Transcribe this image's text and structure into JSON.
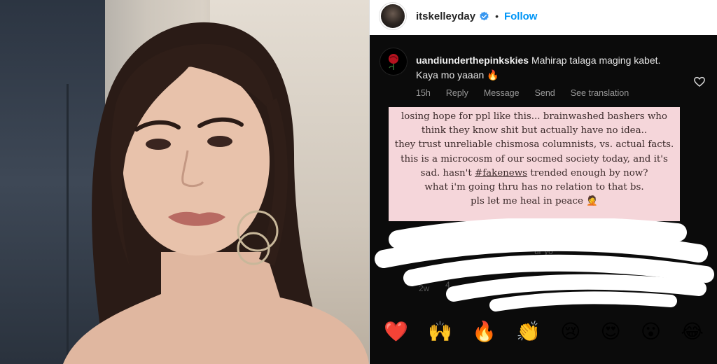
{
  "profile": {
    "username": "itskelleyday",
    "follow_label": "Follow",
    "separator": "•"
  },
  "comment": {
    "username": "uandiunderthepinkskies",
    "text": "Mahirap talaga maging kabet. Kaya mo yaaan 🔥",
    "meta": {
      "time": "15h",
      "reply": "Reply",
      "message": "Message",
      "send": "Send",
      "translate": "See translation"
    }
  },
  "story_caption": {
    "lines": [
      "losing hope for ppl like this... brainwashed bashers who",
      "think they know shit but actually have no idea..",
      "they trust unreliable chismosa columnists, vs. actual facts.",
      "this is a microcosm of our socmed society today, and it's",
      "sad. hasn't",
      "#fakenews",
      "trended enough by now?",
      "what i'm going thru has no relation to that bs.",
      "pls let me heal in peace 🤦"
    ]
  },
  "obscured": {
    "word1": "ve",
    "word2": "ur yo",
    "time": "2w",
    "digit": "4"
  },
  "reactions": [
    "❤️",
    "🙌",
    "🔥",
    "👏",
    "😢",
    "😍",
    "😮",
    "😂"
  ],
  "colors": {
    "accent": "#0095f6",
    "verified": "#3897f0",
    "caption_bg": "#f5d6da",
    "story_bg": "#0b0b0b"
  },
  "icons": {
    "verified": "verified-badge-icon",
    "heart": "heart-outline-icon",
    "rose": "rose-icon"
  }
}
